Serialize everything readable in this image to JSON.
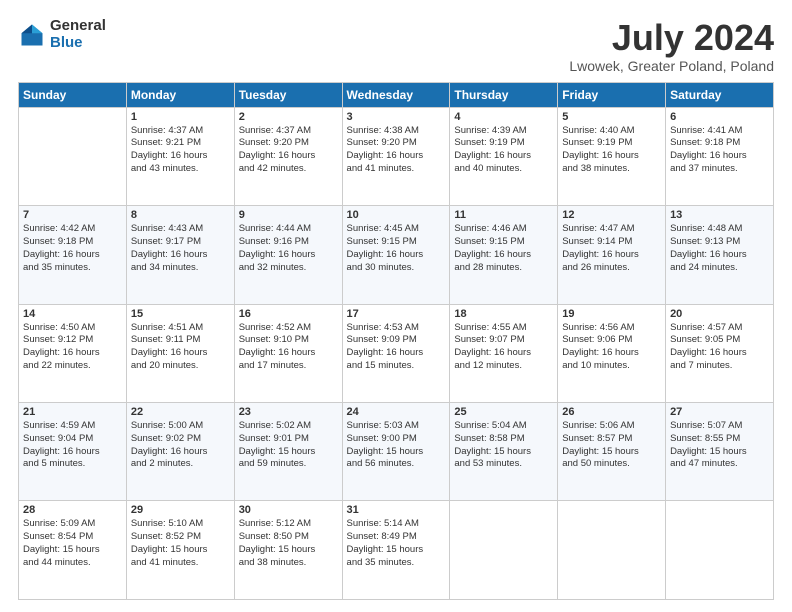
{
  "header": {
    "logo_general": "General",
    "logo_blue": "Blue",
    "month_year": "July 2024",
    "location": "Lwowek, Greater Poland, Poland"
  },
  "weekdays": [
    "Sunday",
    "Monday",
    "Tuesday",
    "Wednesday",
    "Thursday",
    "Friday",
    "Saturday"
  ],
  "weeks": [
    [
      {
        "day": "",
        "sunrise": "",
        "sunset": "",
        "daylight": ""
      },
      {
        "day": "1",
        "sunrise": "Sunrise: 4:37 AM",
        "sunset": "Sunset: 9:21 PM",
        "daylight": "Daylight: 16 hours and 43 minutes."
      },
      {
        "day": "2",
        "sunrise": "Sunrise: 4:37 AM",
        "sunset": "Sunset: 9:20 PM",
        "daylight": "Daylight: 16 hours and 42 minutes."
      },
      {
        "day": "3",
        "sunrise": "Sunrise: 4:38 AM",
        "sunset": "Sunset: 9:20 PM",
        "daylight": "Daylight: 16 hours and 41 minutes."
      },
      {
        "day": "4",
        "sunrise": "Sunrise: 4:39 AM",
        "sunset": "Sunset: 9:19 PM",
        "daylight": "Daylight: 16 hours and 40 minutes."
      },
      {
        "day": "5",
        "sunrise": "Sunrise: 4:40 AM",
        "sunset": "Sunset: 9:19 PM",
        "daylight": "Daylight: 16 hours and 38 minutes."
      },
      {
        "day": "6",
        "sunrise": "Sunrise: 4:41 AM",
        "sunset": "Sunset: 9:18 PM",
        "daylight": "Daylight: 16 hours and 37 minutes."
      }
    ],
    [
      {
        "day": "7",
        "sunrise": "Sunrise: 4:42 AM",
        "sunset": "Sunset: 9:18 PM",
        "daylight": "Daylight: 16 hours and 35 minutes."
      },
      {
        "day": "8",
        "sunrise": "Sunrise: 4:43 AM",
        "sunset": "Sunset: 9:17 PM",
        "daylight": "Daylight: 16 hours and 34 minutes."
      },
      {
        "day": "9",
        "sunrise": "Sunrise: 4:44 AM",
        "sunset": "Sunset: 9:16 PM",
        "daylight": "Daylight: 16 hours and 32 minutes."
      },
      {
        "day": "10",
        "sunrise": "Sunrise: 4:45 AM",
        "sunset": "Sunset: 9:15 PM",
        "daylight": "Daylight: 16 hours and 30 minutes."
      },
      {
        "day": "11",
        "sunrise": "Sunrise: 4:46 AM",
        "sunset": "Sunset: 9:15 PM",
        "daylight": "Daylight: 16 hours and 28 minutes."
      },
      {
        "day": "12",
        "sunrise": "Sunrise: 4:47 AM",
        "sunset": "Sunset: 9:14 PM",
        "daylight": "Daylight: 16 hours and 26 minutes."
      },
      {
        "day": "13",
        "sunrise": "Sunrise: 4:48 AM",
        "sunset": "Sunset: 9:13 PM",
        "daylight": "Daylight: 16 hours and 24 minutes."
      }
    ],
    [
      {
        "day": "14",
        "sunrise": "Sunrise: 4:50 AM",
        "sunset": "Sunset: 9:12 PM",
        "daylight": "Daylight: 16 hours and 22 minutes."
      },
      {
        "day": "15",
        "sunrise": "Sunrise: 4:51 AM",
        "sunset": "Sunset: 9:11 PM",
        "daylight": "Daylight: 16 hours and 20 minutes."
      },
      {
        "day": "16",
        "sunrise": "Sunrise: 4:52 AM",
        "sunset": "Sunset: 9:10 PM",
        "daylight": "Daylight: 16 hours and 17 minutes."
      },
      {
        "day": "17",
        "sunrise": "Sunrise: 4:53 AM",
        "sunset": "Sunset: 9:09 PM",
        "daylight": "Daylight: 16 hours and 15 minutes."
      },
      {
        "day": "18",
        "sunrise": "Sunrise: 4:55 AM",
        "sunset": "Sunset: 9:07 PM",
        "daylight": "Daylight: 16 hours and 12 minutes."
      },
      {
        "day": "19",
        "sunrise": "Sunrise: 4:56 AM",
        "sunset": "Sunset: 9:06 PM",
        "daylight": "Daylight: 16 hours and 10 minutes."
      },
      {
        "day": "20",
        "sunrise": "Sunrise: 4:57 AM",
        "sunset": "Sunset: 9:05 PM",
        "daylight": "Daylight: 16 hours and 7 minutes."
      }
    ],
    [
      {
        "day": "21",
        "sunrise": "Sunrise: 4:59 AM",
        "sunset": "Sunset: 9:04 PM",
        "daylight": "Daylight: 16 hours and 5 minutes."
      },
      {
        "day": "22",
        "sunrise": "Sunrise: 5:00 AM",
        "sunset": "Sunset: 9:02 PM",
        "daylight": "Daylight: 16 hours and 2 minutes."
      },
      {
        "day": "23",
        "sunrise": "Sunrise: 5:02 AM",
        "sunset": "Sunset: 9:01 PM",
        "daylight": "Daylight: 15 hours and 59 minutes."
      },
      {
        "day": "24",
        "sunrise": "Sunrise: 5:03 AM",
        "sunset": "Sunset: 9:00 PM",
        "daylight": "Daylight: 15 hours and 56 minutes."
      },
      {
        "day": "25",
        "sunrise": "Sunrise: 5:04 AM",
        "sunset": "Sunset: 8:58 PM",
        "daylight": "Daylight: 15 hours and 53 minutes."
      },
      {
        "day": "26",
        "sunrise": "Sunrise: 5:06 AM",
        "sunset": "Sunset: 8:57 PM",
        "daylight": "Daylight: 15 hours and 50 minutes."
      },
      {
        "day": "27",
        "sunrise": "Sunrise: 5:07 AM",
        "sunset": "Sunset: 8:55 PM",
        "daylight": "Daylight: 15 hours and 47 minutes."
      }
    ],
    [
      {
        "day": "28",
        "sunrise": "Sunrise: 5:09 AM",
        "sunset": "Sunset: 8:54 PM",
        "daylight": "Daylight: 15 hours and 44 minutes."
      },
      {
        "day": "29",
        "sunrise": "Sunrise: 5:10 AM",
        "sunset": "Sunset: 8:52 PM",
        "daylight": "Daylight: 15 hours and 41 minutes."
      },
      {
        "day": "30",
        "sunrise": "Sunrise: 5:12 AM",
        "sunset": "Sunset: 8:50 PM",
        "daylight": "Daylight: 15 hours and 38 minutes."
      },
      {
        "day": "31",
        "sunrise": "Sunrise: 5:14 AM",
        "sunset": "Sunset: 8:49 PM",
        "daylight": "Daylight: 15 hours and 35 minutes."
      },
      {
        "day": "",
        "sunrise": "",
        "sunset": "",
        "daylight": ""
      },
      {
        "day": "",
        "sunrise": "",
        "sunset": "",
        "daylight": ""
      },
      {
        "day": "",
        "sunrise": "",
        "sunset": "",
        "daylight": ""
      }
    ]
  ]
}
